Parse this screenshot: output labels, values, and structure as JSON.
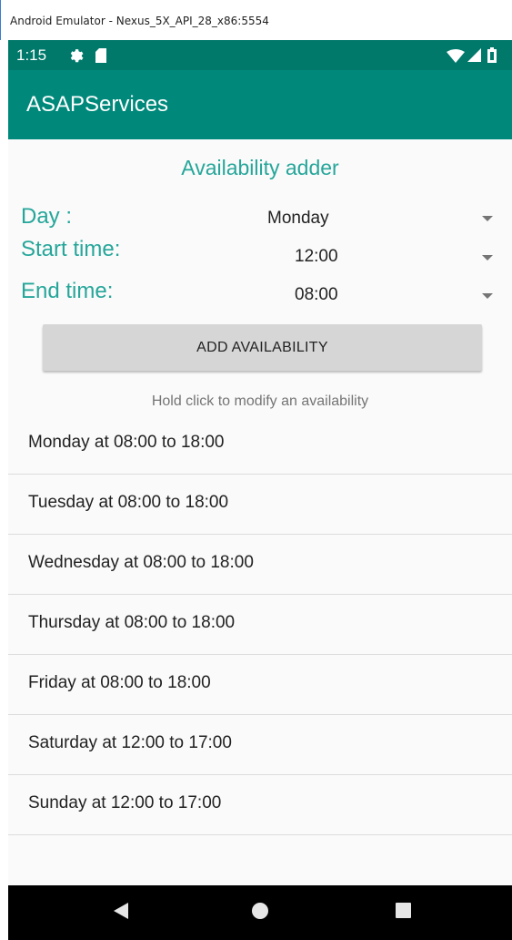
{
  "window": {
    "title": "Android Emulator - Nexus_5X_API_28_x86:5554"
  },
  "status_bar": {
    "time": "1:15",
    "icons_left": [
      "gear-icon",
      "sd-card-icon"
    ],
    "icons_right": [
      "wifi-icon",
      "cell-signal-icon",
      "battery-icon"
    ]
  },
  "app_bar": {
    "title": "ASAPServices"
  },
  "form": {
    "heading": "Availability adder",
    "day_label": "Day :",
    "day_value": "Monday",
    "start_label": "Start time:",
    "start_value": "12:00",
    "end_label": "End time:",
    "end_value": "08:00",
    "add_button": "ADD AVAILABILITY",
    "hint": "Hold click to modify an availability"
  },
  "availabilities": [
    "Monday at 08:00 to 18:00",
    "Tuesday at 08:00 to 18:00",
    "Wednesday at 08:00 to 18:00",
    "Thursday at 08:00 to 18:00",
    "Friday at 08:00 to 18:00",
    "Saturday at 12:00 to 17:00",
    "Sunday at 12:00 to 17:00"
  ],
  "nav_bar": {
    "buttons": [
      "back-icon",
      "home-icon",
      "recents-icon"
    ]
  },
  "colors": {
    "status_bar": "#00796b",
    "app_bar": "#00897b",
    "accent_text": "#26a69a",
    "button": "#d6d6d6"
  }
}
